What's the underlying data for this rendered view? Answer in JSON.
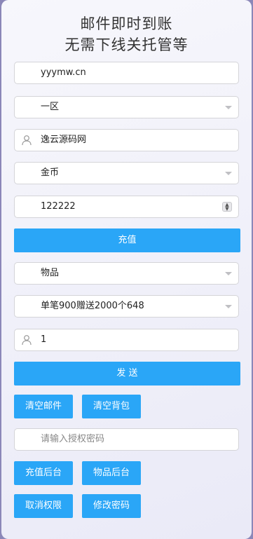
{
  "header": {
    "line1": "邮件即时到账",
    "line2": "无需下线关托管等"
  },
  "form": {
    "server_url": "yyymw.cn",
    "zone_select": "一区",
    "account": "逸云源码网",
    "currency_select": "金币",
    "amount": "122222",
    "recharge_label": "充值",
    "item_type_select": "物品",
    "item_select": "单笔900赠送2000个648",
    "quantity": "1",
    "send_label": "发 送",
    "clear_mail_label": "清空邮件",
    "clear_bag_label": "清空背包",
    "auth_placeholder": "请输入授权密码",
    "recharge_backend_label": "充值后台",
    "item_backend_label": "物品后台",
    "revoke_label": "取消权限",
    "change_password_label": "修改密码"
  },
  "icons": {
    "account": "user-icon",
    "quantity": "user-icon",
    "dropdown": "chevron-down-icon",
    "stepper": "stepper-icon"
  },
  "colors": {
    "accent": "#2aa6f7",
    "background": "#f4f4fb",
    "frame": "#8b87b8"
  }
}
